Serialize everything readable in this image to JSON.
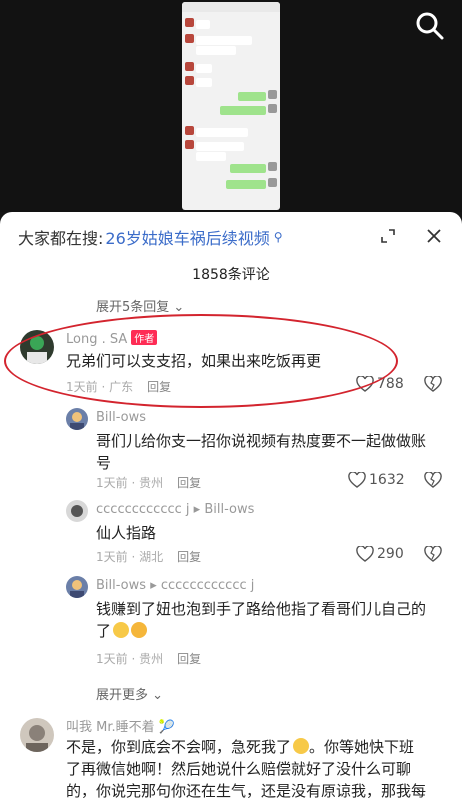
{
  "header": {
    "search_prefix": "大家都在搜:",
    "search_term": "26岁姑娘车祸后续视频",
    "comment_count": "1858条评论",
    "expand_top": "展开5条回复"
  },
  "comments": [
    {
      "name": "Long . SA",
      "tag": "作者",
      "text": "兄弟们可以支支招，如果出来吃饭再更",
      "time": "1天前 · 广东",
      "reply": "回复",
      "likes": "788"
    },
    {
      "name": "Bill-ows",
      "text_line1": "哥们儿给你支一招你说视频有热度要不一起做做账",
      "text_line2": "号",
      "time": "1天前 · 贵州",
      "reply": "回复",
      "likes": "1632"
    },
    {
      "name": "cccccccccccc j",
      "reply_to": "Bill-ows",
      "text": "仙人指路",
      "time": "1天前 · 湖北",
      "reply": "回复",
      "likes": "290"
    },
    {
      "name": "Bill-ows",
      "reply_to": "cccccccccccc j",
      "text_line1": "钱赚到了妞也泡到手了路给他指了看哥们儿自己的",
      "text_line2": "了",
      "time": "1天前 · 贵州",
      "reply": "回复"
    },
    {
      "name": "叫我 Mr.睡不着",
      "text_line1": "不是，你到底会不会啊，急死我了",
      "text_line1b": "。你等她快下班",
      "text_line2": "了再微信她啊！然后她说什么赔偿就好了没什么可聊",
      "text_line3": "的，你说完那句你还在生气，还是没有原谅我，那我每"
    }
  ],
  "expand_bottom": "展开更多",
  "icons": {
    "search": "search-icon",
    "fullscreen": "expand-icon",
    "close": "close-icon"
  },
  "colors": {
    "accent_link": "#3b6cc9",
    "author_tag": "#fe2c55",
    "highlight_circle": "#d3242e"
  }
}
